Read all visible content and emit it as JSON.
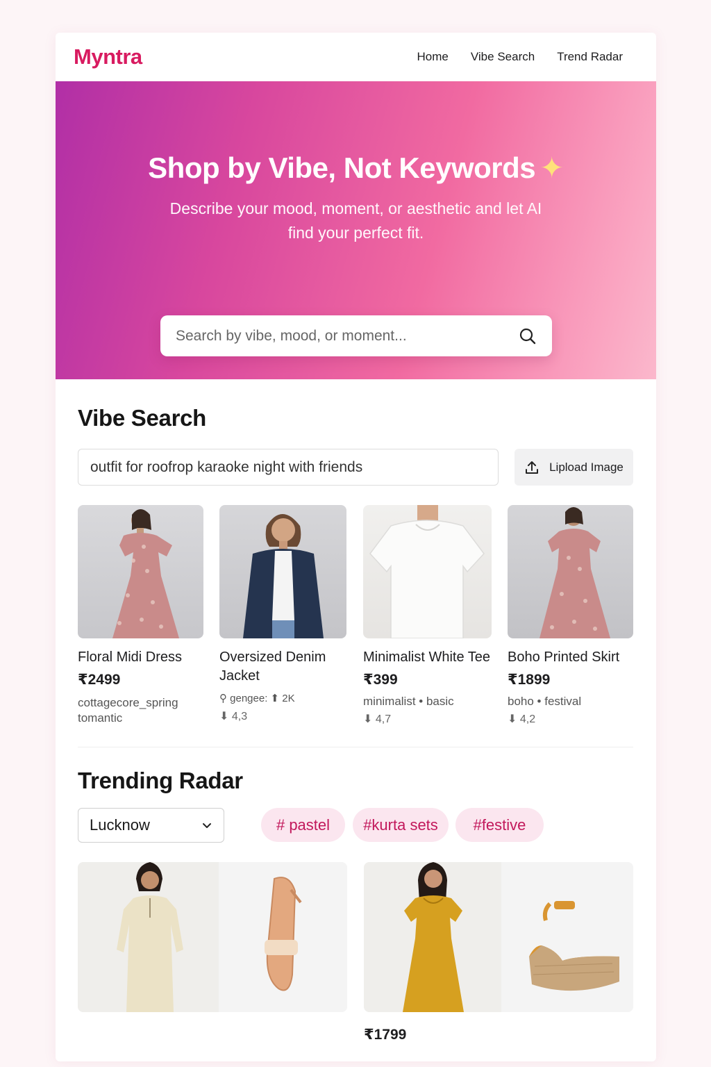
{
  "header": {
    "logo": "Myntra",
    "nav": [
      "Home",
      "Vibe Search",
      "Trend Radar"
    ]
  },
  "hero": {
    "title": "Shop by Vibe, Not Keywords",
    "sparkle": "✦",
    "subtitle": "Describe your mood, moment, or aesthetic and let AI find your perfect fit.",
    "search_placeholder": "Search by vibe, mood, or moment..."
  },
  "vibe_search": {
    "title": "Vibe Search",
    "query": "outfit for roofrop karaoke night with friends",
    "upload_label": "Lipload Image",
    "products": [
      {
        "name": "Floral Midi Dress",
        "price": "₹2499",
        "tags": "cottagecore_spring tomantic",
        "rating": ""
      },
      {
        "name": "Oversized Denim Jacket",
        "price": "",
        "tags": "⚲ gengee: ⬆ 2K",
        "rating": "⬇ 4,3"
      },
      {
        "name": "Minimalist White Tee",
        "price": "₹399",
        "tags": "minimalist • basic",
        "rating": "⬇ 4,7"
      },
      {
        "name": "Boho Printed Skirt",
        "price": "₹1899",
        "tags": "boho • festival",
        "rating": "⬇ 4,2"
      }
    ]
  },
  "trending": {
    "title": "Trending Radar",
    "city": "Lucknow",
    "chips": [
      "# pastel",
      "#kurta sets",
      "#festive"
    ],
    "cards": [
      {
        "price": ""
      },
      {
        "price": "₹1799"
      }
    ]
  },
  "colors": {
    "brand": "#d81b60",
    "chip_bg": "#fbe6ef",
    "chip_text": "#c2185b"
  },
  "icons": [
    "search-icon",
    "upload-icon",
    "chevron-down-icon",
    "sparkle-icon"
  ]
}
